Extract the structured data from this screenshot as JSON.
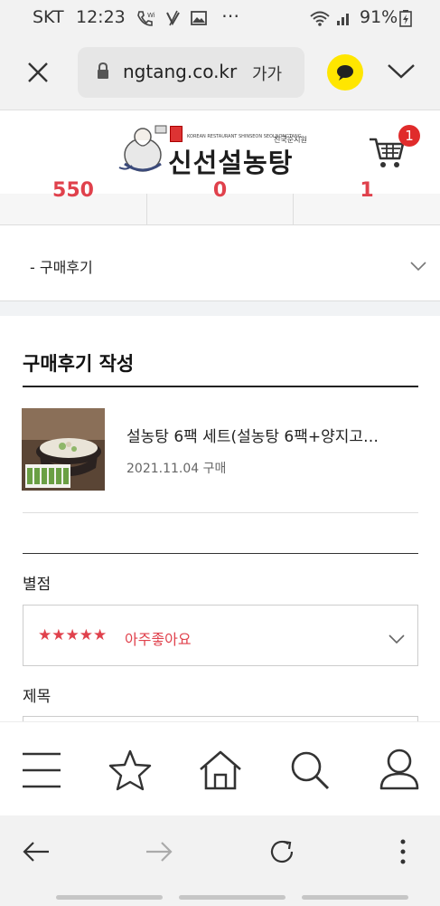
{
  "status_bar": {
    "carrier": "SKT",
    "time": "12:23",
    "battery": "91%"
  },
  "browser": {
    "url": "ngtang.co.kr",
    "font_size_label": "가가",
    "close_icon": "close-icon",
    "lock_icon": "lock-icon"
  },
  "site": {
    "logo_text": "신선설농탕",
    "logo_small_text": "KOREAN RESTAURANT SHINSEON SEOLNONGTANG",
    "logo_sub_text": "진국순시원",
    "cart_count": "1"
  },
  "tabs_partial": [
    "550",
    "0",
    "1"
  ],
  "review_select": {
    "value": "- 구매후기"
  },
  "review_section": {
    "title": "구매후기 작성"
  },
  "product": {
    "name": "설농탕 6팩 세트(설농탕 6팩+양지고…",
    "date": "2021.11.04 구매"
  },
  "form": {
    "rating_label": "별점",
    "rating_stars": "★★★★★",
    "rating_value": "아주좋아요",
    "title_label": "제목"
  },
  "colors": {
    "accent_red": "#e0414c",
    "kakao_yellow": "#ffe600",
    "badge_red": "#e02b2b"
  }
}
